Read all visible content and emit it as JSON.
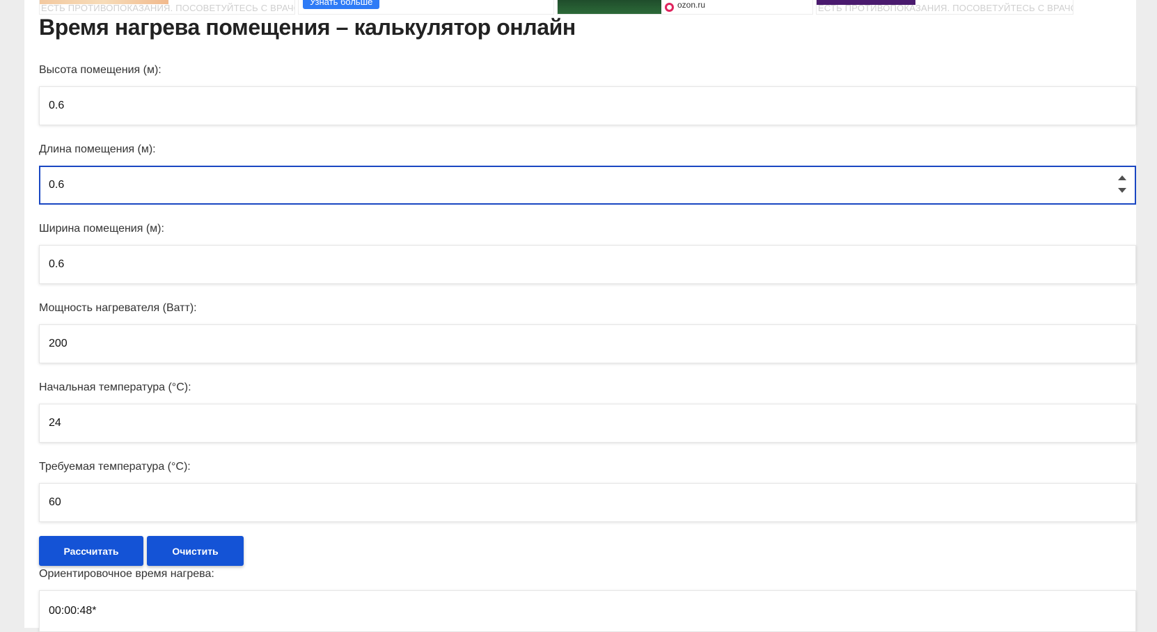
{
  "ads": {
    "disclaimer_left": "ЕСТЬ ПРОТИВОПОКАЗАНИЯ. ПОСОВЕТУЙТЕСЬ С ВРАЧОМ",
    "disclaimer_right": "ЕСТЬ ПРОТИВОПОКАЗАНИЯ. ПОСОВЕТУЙТЕСЬ С ВРАЧОМ",
    "learn_more": "Узнать больше",
    "ozon": "ozon.ru"
  },
  "title": "Время нагрева помещения – калькулятор онлайн",
  "fields": [
    {
      "label": "Высота помещения (м):",
      "value": "0.6"
    },
    {
      "label": "Длина помещения (м):",
      "value": "0.6"
    },
    {
      "label": "Ширина помещения (м):",
      "value": "0.6"
    },
    {
      "label": "Мощность нагревателя (Ватт):",
      "value": "200"
    },
    {
      "label": "Начальная температура (°С):",
      "value": "24"
    },
    {
      "label": "Требуемая температура (°С):",
      "value": "60"
    }
  ],
  "buttons": {
    "calculate": "Рассчитать",
    "clear": "Очистить"
  },
  "result": {
    "label": "Ориентировочное время нагрева:",
    "value": "00:00:48*"
  },
  "colors": {
    "accent": "#1453d6",
    "focus_border": "#1a47c2"
  }
}
